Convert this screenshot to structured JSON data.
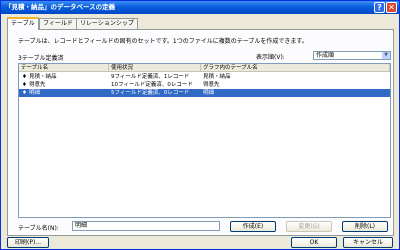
{
  "window": {
    "title": "「見積・納品」のデータベースの定義"
  },
  "titlebar": {
    "help_glyph": "?",
    "close_glyph": "✕"
  },
  "tabs": [
    "テーブル",
    "フィールド",
    "リレーションシップ"
  ],
  "description": "テーブルは、レコードとフィールドの固有のセットです。1つのファイルに複数のテーブルを作成できます。",
  "table_count": "3テーブル定義済",
  "sort": {
    "label": "表示順(V):",
    "value": "作成順",
    "arrow": "▼"
  },
  "columns": [
    "テーブル名",
    "使用状況",
    "グラフ内のテーブル名"
  ],
  "rows": [
    {
      "marker": "♦",
      "name": "見積・納品",
      "usage": "9フィールド定義済、1レコード",
      "graph_name": "見積・納品",
      "selected": false
    },
    {
      "marker": "♦",
      "name": "得意先",
      "usage": "10フィールド定義済、0レコード",
      "graph_name": "得意先",
      "selected": false
    },
    {
      "marker": "♦",
      "name": "明細",
      "usage": "5フィールド定義済、0レコード",
      "graph_name": "明細",
      "selected": true
    }
  ],
  "table_name_label": "テーブル名(N):",
  "table_name_value": "明細",
  "buttons": {
    "create": "作成(E)",
    "change": "変更(G)",
    "delete": "削除(L)",
    "print": "印刷(P)...",
    "ok": "OK",
    "cancel": "キャンセル"
  }
}
